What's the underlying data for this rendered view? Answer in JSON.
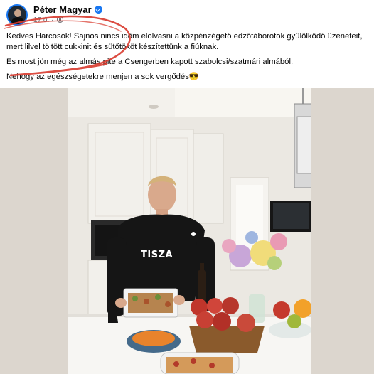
{
  "post": {
    "author": "Péter Magyar",
    "time": "17 ó.",
    "verified_color": "#1877f2",
    "text": [
      "Kedves Harcosok! Sajnos nincs időm elolvasni a közpénzégető edzőtáborotok gyűlölködő üzeneteit,",
      "mert lilvel töltött cukkinit és sütőtököt készítettünk a fiúknak.",
      "Es most jön még az almás pite a Csengerben kapott szabolcsi/szatmári almából.",
      "Nehogy az egészségetekre menjen a sok vergődés😎"
    ]
  },
  "photo": {
    "hoodie_logo": "TISZA"
  },
  "colors": {
    "annotation": "#d83a2e",
    "hoodie": "#151515"
  },
  "icons": [
    "avatar",
    "verified-icon",
    "globe-icon"
  ]
}
